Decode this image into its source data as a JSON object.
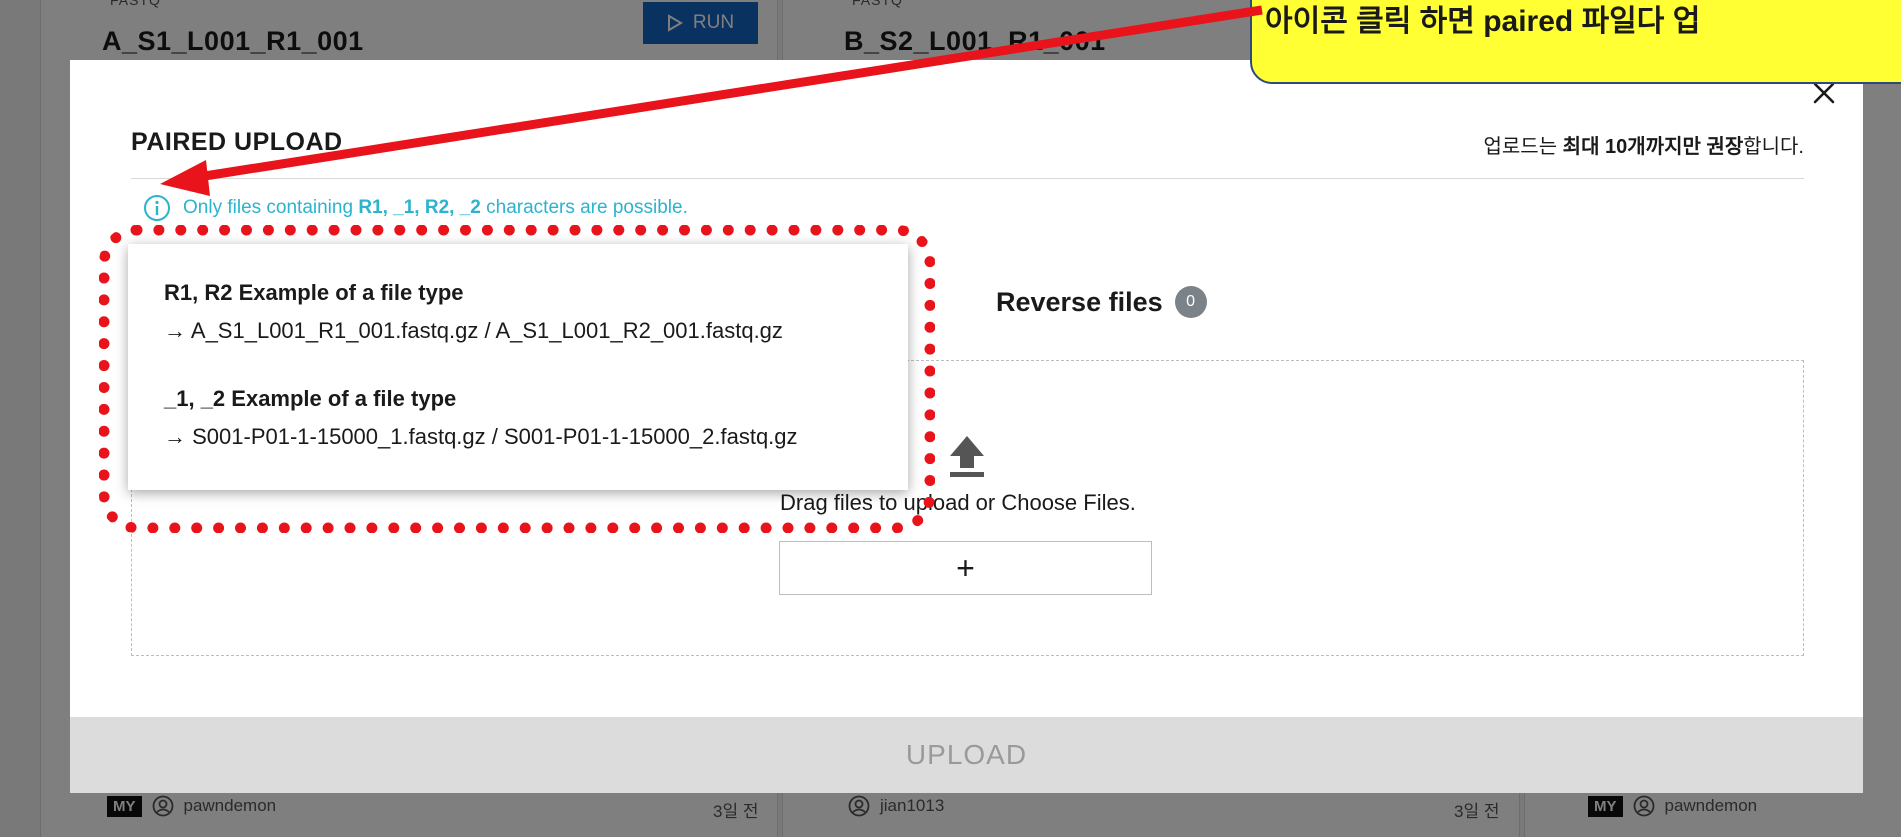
{
  "background": {
    "cards": [
      {
        "tag": "FASTQ",
        "title": "A_S1_L001_R1_001",
        "run_label": "RUN",
        "my_badge": "MY",
        "user": "pawndemon",
        "days": "3일 전"
      },
      {
        "tag": "FASTQ",
        "title": "B_S2_L001_R1_001",
        "my_badge": "",
        "user": "jian1013",
        "days": "3일 전"
      },
      {
        "my_badge": "MY",
        "user": "pawndemon"
      }
    ]
  },
  "modal": {
    "title": "PAIRED UPLOAD",
    "notice_prefix": "업로드는 ",
    "notice_bold": "최대 10개까지만 권장",
    "notice_suffix": "합니다.",
    "info_prefix": "Only files containing ",
    "info_bold": "R1, _1, R2, _2",
    "info_suffix": " characters are possible.",
    "reverse_files_label": "Reverse files",
    "reverse_files_count": "0",
    "drop_text": "Drag files to upload or Choose Files.",
    "add_button_label": "+",
    "upload_label": "UPLOAD"
  },
  "tooltip": {
    "r_heading": "R1, R2 Example of a file type",
    "r_example": "→ A_S1_L001_R1_001.fastq.gz / A_S1_L001_R2_001.fastq.gz",
    "u_heading": "_1, _2 Example of a file type",
    "u_example": "→ S001-P01-1-15000_1.fastq.gz / S001-P01-1-15000_2.fastq.gz"
  },
  "annotation": {
    "callout_text": "아이콘 클릭 하면 paired 파일다 업",
    "colors": {
      "highlight": "#e8131b",
      "callout_bg": "#ffff33"
    }
  },
  "colors": {
    "info": "#2bb3d0",
    "run_button": "#1565c0",
    "badge": "#7b8389"
  }
}
